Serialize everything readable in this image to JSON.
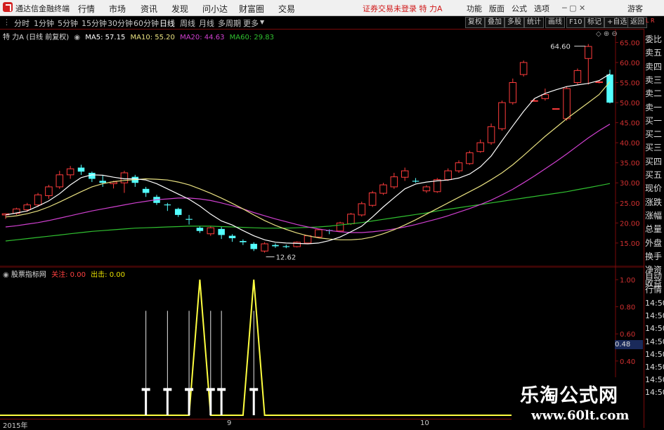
{
  "top_bar": {
    "app_title": "通达信金融终端",
    "menu": [
      "行情",
      "市场",
      "资讯",
      "发现",
      "问小达",
      "财富圈",
      "交易"
    ],
    "trade_status": "证券交易未登录  特 力A",
    "right_menu": [
      "功能",
      "版面",
      "公式",
      "选项"
    ],
    "guest": "游客"
  },
  "period_bar": {
    "periods": [
      "分时",
      "1分钟",
      "5分钟",
      "15分钟",
      "30分钟",
      "60分钟",
      "日线",
      "周线",
      "月线",
      "多周期",
      "更多"
    ],
    "active": "日线",
    "buttons": [
      "复权",
      "叠加",
      "多股",
      "统计",
      "画线",
      "F10",
      "标记",
      "+自选",
      "返回"
    ]
  },
  "info_line": {
    "stock": "特 力A (日线 前复权)",
    "ma5": "MA5: 57.15",
    "ma10": "MA10: 55.20",
    "ma20": "MA20: 44.63",
    "ma60": "MA60: 29.83",
    "colors": {
      "ma5": "#ffffff",
      "ma10": "#e8e080",
      "ma20": "#d040d0",
      "ma60": "#30c030"
    }
  },
  "main_chart": {
    "y_ticks": [
      "65.00",
      "60.00",
      "55.00",
      "50.00",
      "45.00",
      "40.00",
      "35.00",
      "30.00",
      "25.00",
      "20.00",
      "15.00"
    ],
    "y_range": [
      12,
      67
    ],
    "high_label": "64.60",
    "low_label": "12.62",
    "candles": [
      [
        22.0,
        22.3,
        21.0,
        22.4
      ],
      [
        22.4,
        23.5,
        22.0,
        23.8
      ],
      [
        23.3,
        24.5,
        22.8,
        25.0
      ],
      [
        24.5,
        27.0,
        24.0,
        27.5
      ],
      [
        26.8,
        29.0,
        26.0,
        29.5
      ],
      [
        29.0,
        32.0,
        28.5,
        33.0
      ],
      [
        32.0,
        33.5,
        31.0,
        34.2
      ],
      [
        33.8,
        32.8,
        32.0,
        34.5
      ],
      [
        32.5,
        31.0,
        30.2,
        32.8
      ],
      [
        30.5,
        30.0,
        29.0,
        31.8
      ],
      [
        29.8,
        30.2,
        28.6,
        30.5
      ],
      [
        30.0,
        32.5,
        27.5,
        33.0
      ],
      [
        31.5,
        30.0,
        29.0,
        32.0
      ],
      [
        28.5,
        27.5,
        26.5,
        29.0
      ],
      [
        26.5,
        25.0,
        24.5,
        27.0
      ],
      [
        24.6,
        24.4,
        23.0,
        25.0
      ],
      [
        23.5,
        22.0,
        21.5,
        23.8
      ],
      [
        21.0,
        20.8,
        19.6,
        22.0
      ],
      [
        18.8,
        18.0,
        17.5,
        19.2
      ],
      [
        17.3,
        18.8,
        16.8,
        19.2
      ],
      [
        18.5,
        17.0,
        16.0,
        19.0
      ],
      [
        16.8,
        16.2,
        15.3,
        17.2
      ],
      [
        15.5,
        15.2,
        14.5,
        15.9
      ],
      [
        14.8,
        13.5,
        13.0,
        15.2
      ],
      [
        13.0,
        14.8,
        12.6,
        15.2
      ],
      [
        14.5,
        14.2,
        13.8,
        14.9
      ],
      [
        14.2,
        14.0,
        13.7,
        14.6
      ],
      [
        14.1,
        15.2,
        13.9,
        15.4
      ],
      [
        15.0,
        16.8,
        14.8,
        17.0
      ],
      [
        16.5,
        18.3,
        16.2,
        18.5
      ],
      [
        18.2,
        18.0,
        17.2,
        18.4
      ],
      [
        18.0,
        20.0,
        17.8,
        20.3
      ],
      [
        19.8,
        22.2,
        19.5,
        22.5
      ],
      [
        22.0,
        24.8,
        21.6,
        25.3
      ],
      [
        24.4,
        27.5,
        24.0,
        28.0
      ],
      [
        27.4,
        29.5,
        27.0,
        30.0
      ],
      [
        29.0,
        31.5,
        28.5,
        32.5
      ],
      [
        31.4,
        33.0,
        30.5,
        33.8
      ],
      [
        30.5,
        30.3,
        30.0,
        31.2
      ],
      [
        28.0,
        29.0,
        27.5,
        29.4
      ],
      [
        27.8,
        30.8,
        27.5,
        31.2
      ],
      [
        30.8,
        33.0,
        30.5,
        33.6
      ],
      [
        33.0,
        35.0,
        32.5,
        35.6
      ],
      [
        34.8,
        37.5,
        34.5,
        38.0
      ],
      [
        37.8,
        40.0,
        37.5,
        40.8
      ],
      [
        40.0,
        44.0,
        39.5,
        44.8
      ],
      [
        43.5,
        50.0,
        43.0,
        50.5
      ],
      [
        50.0,
        55.0,
        49.5,
        56.0
      ],
      [
        57.0,
        60.0,
        56.5,
        60.5
      ],
      [
        50.5,
        50.5,
        50.3,
        51.0
      ],
      [
        51.0,
        52.0,
        50.5,
        53.5
      ],
      [
        48.5,
        48.5,
        48.5,
        48.5
      ],
      [
        46.0,
        53.5,
        45.5,
        54.0
      ],
      [
        55.0,
        58.0,
        54.5,
        58.5
      ],
      [
        61.0,
        64.0,
        54.5,
        64.6
      ],
      [
        55.0,
        55.2,
        54.8,
        55.5
      ],
      [
        57.0,
        50.0,
        49.8,
        58.2
      ]
    ],
    "ma_lines": {
      "ma5": [
        22.0,
        22.5,
        23.0,
        24.2,
        25.5,
        27.3,
        29.5,
        31.3,
        32.0,
        31.9,
        31.4,
        31.0,
        31.0,
        30.7,
        29.8,
        28.5,
        27.2,
        25.9,
        24.2,
        22.2,
        20.5,
        19.5,
        18.1,
        16.8,
        15.8,
        15.2,
        15.0,
        14.9,
        14.8,
        15.0,
        15.6,
        16.5,
        17.8,
        19.2,
        21.5,
        24.0,
        26.3,
        28.5,
        29.7,
        30.2,
        30.5,
        30.7,
        31.2,
        32.2,
        34.0,
        36.7,
        40.5,
        44.2,
        47.8,
        51.0,
        52.3,
        53.2,
        54.0,
        54.4,
        54.8,
        55.5,
        57.15
      ],
      "ma10": [
        21.5,
        21.8,
        22.3,
        23.0,
        24.0,
        25.2,
        26.5,
        27.8,
        29.0,
        29.8,
        30.3,
        30.6,
        30.8,
        31.0,
        30.9,
        30.7,
        30.2,
        29.5,
        28.5,
        27.4,
        26.2,
        24.9,
        23.5,
        22.0,
        20.6,
        19.4,
        18.4,
        17.5,
        16.8,
        16.3,
        16.0,
        15.8,
        15.8,
        16.0,
        16.5,
        17.3,
        18.3,
        19.5,
        20.8,
        22.2,
        23.6,
        25.0,
        26.4,
        27.8,
        29.2,
        30.8,
        32.5,
        34.5,
        36.8,
        39.2,
        41.6,
        43.8,
        46.0,
        48.0,
        50.0,
        52.0,
        55.2
      ],
      "ma20": [
        19.0,
        19.3,
        19.7,
        20.1,
        20.6,
        21.2,
        21.8,
        22.4,
        23.0,
        23.5,
        24.0,
        24.5,
        25.0,
        25.4,
        25.8,
        26.0,
        26.2,
        26.2,
        26.0,
        25.6,
        25.0,
        24.3,
        23.5,
        22.6,
        21.8,
        21.0,
        20.3,
        19.6,
        19.0,
        18.5,
        18.1,
        17.8,
        17.6,
        17.6,
        17.8,
        18.1,
        18.5,
        19.0,
        19.6,
        20.3,
        21.0,
        21.8,
        22.7,
        23.6,
        24.6,
        25.7,
        27.0,
        28.4,
        30.0,
        31.7,
        33.5,
        35.3,
        37.2,
        39.2,
        41.2,
        43.0,
        44.63
      ],
      "ma60": [
        15.5,
        15.8,
        16.1,
        16.4,
        16.7,
        17.0,
        17.3,
        17.6,
        17.9,
        18.1,
        18.3,
        18.5,
        18.7,
        18.8,
        18.9,
        19.0,
        19.1,
        19.2,
        19.2,
        19.2,
        19.1,
        19.0,
        18.9,
        18.8,
        18.7,
        18.7,
        18.7,
        18.8,
        18.9,
        19.0,
        19.2,
        19.5,
        19.8,
        20.1,
        20.5,
        20.9,
        21.3,
        21.7,
        22.1,
        22.5,
        23.0,
        23.4,
        23.8,
        24.2,
        24.6,
        25.0,
        25.4,
        25.8,
        26.2,
        26.6,
        27.0,
        27.4,
        27.8,
        28.3,
        28.8,
        29.3,
        29.83
      ]
    }
  },
  "indicator": {
    "name": "股票指标网",
    "label1": "关注",
    "value1": "0.00",
    "label2": "出击",
    "value2": "0.00",
    "y_ticks": [
      "1.00",
      "0.80",
      "0.60",
      "0.40",
      "0.20"
    ],
    "current": "0.48",
    "white_spikes": [
      13,
      15,
      17,
      19,
      20,
      23
    ],
    "yellow_peaks": [
      18,
      23
    ]
  },
  "x_dates": [
    "2015年",
    "9",
    "10"
  ],
  "sidebar": [
    "委比",
    "卖五",
    "卖四",
    "卖三",
    "卖二",
    "卖一",
    "买一",
    "买二",
    "买三",
    "买四",
    "买五",
    "现价",
    "涨跌",
    "涨幅",
    "总量",
    "外盘",
    "换手",
    "净资",
    "收益",
    "自动",
    "行情",
    "14:50",
    "14:50",
    "14:50",
    "14:50",
    "14:50",
    "14:50",
    "14:50",
    "14:50"
  ],
  "watermark": {
    "cn": "乐淘公式网",
    "url": "www.60lt.com"
  }
}
